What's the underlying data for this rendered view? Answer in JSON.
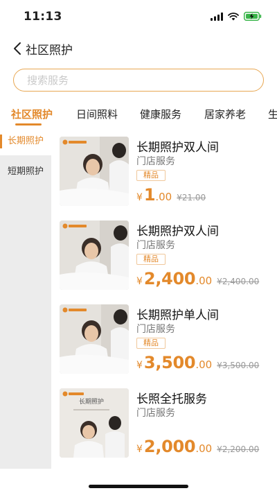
{
  "status": {
    "time": "11:13"
  },
  "nav": {
    "title": "社区照护"
  },
  "search": {
    "placeholder": "搜索服务"
  },
  "tabs": [
    {
      "label": "社区照护"
    },
    {
      "label": "日间照料"
    },
    {
      "label": "健康服务"
    },
    {
      "label": "居家养老"
    },
    {
      "label": "生"
    }
  ],
  "sidebar": {
    "items": [
      {
        "label": "长期照护"
      },
      {
        "label": "短期照护"
      }
    ]
  },
  "products": [
    {
      "title": "长期照护双人间",
      "subtitle": "门店服务",
      "badge": "精品",
      "currency": "¥",
      "price_int": "1",
      "price_dec": ".00",
      "original": "¥21.00",
      "thumb_logo": "",
      "thumb_caption": ""
    },
    {
      "title": "长期照护双人间",
      "subtitle": "门店服务",
      "badge": "精品",
      "currency": "¥",
      "price_int": "2,400",
      "price_dec": ".00",
      "original": "¥2,400.00",
      "thumb_logo": "",
      "thumb_caption": ""
    },
    {
      "title": "长期照护单人间",
      "subtitle": "门店服务",
      "badge": "精品",
      "currency": "¥",
      "price_int": "3,500",
      "price_dec": ".00",
      "original": "¥3,500.00",
      "thumb_logo": "",
      "thumb_caption": ""
    },
    {
      "title": "长照全托服务",
      "subtitle": "门店服务",
      "badge": "",
      "currency": "¥",
      "price_int": "2,000",
      "price_dec": ".00",
      "original": "¥2,200.00",
      "thumb_logo": "",
      "thumb_caption": "长期照护"
    }
  ],
  "colors": {
    "accent": "#e3892b",
    "sidebar_bg": "#ececec",
    "search_border": "#e8a752"
  }
}
